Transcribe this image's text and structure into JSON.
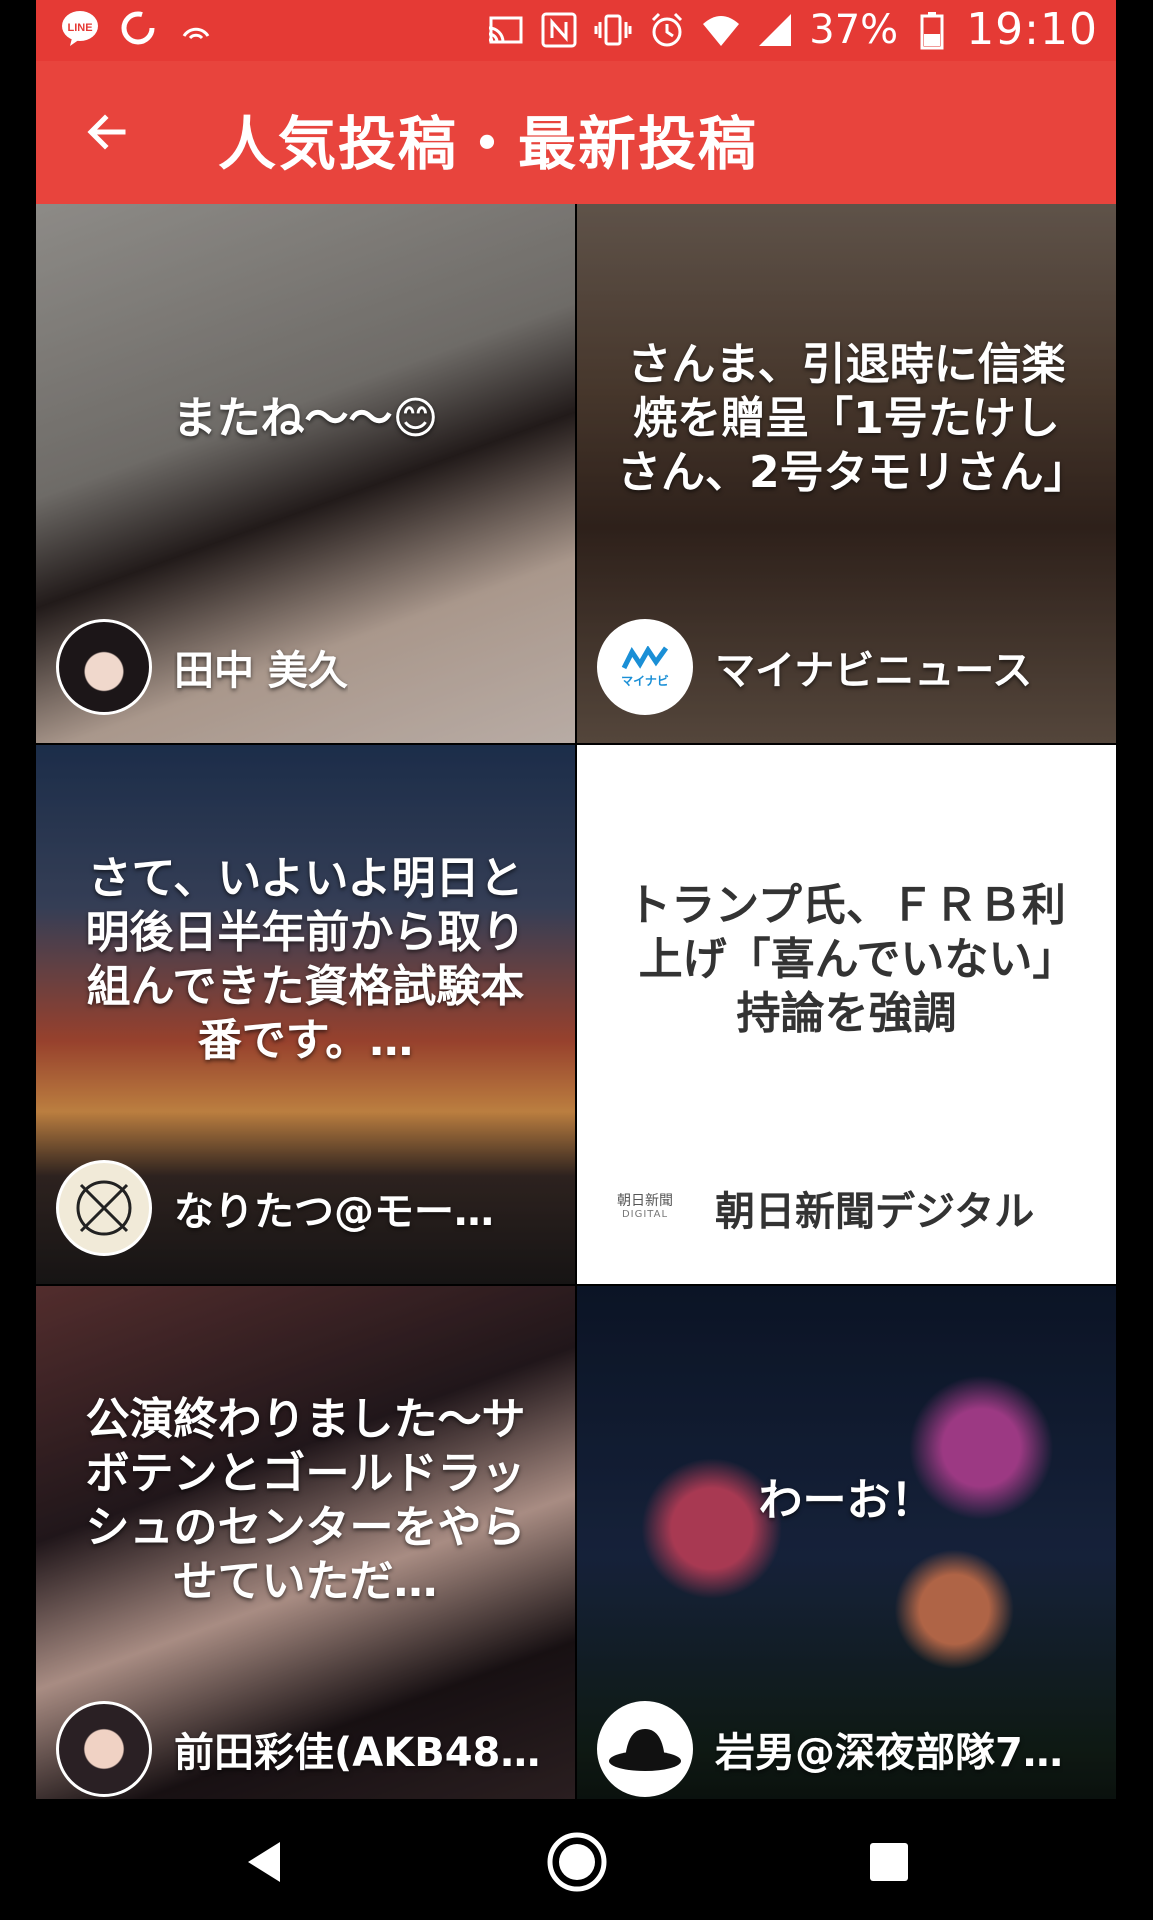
{
  "status_bar": {
    "battery": "37%",
    "time": "19:10",
    "icons": [
      "line-icon",
      "sync-icon",
      "signal-arc-icon",
      "cast-icon",
      "nfc-icon",
      "vibrate-icon",
      "alarm-icon",
      "wifi-icon",
      "cell-signal-icon",
      "battery-icon"
    ]
  },
  "app_bar": {
    "title": "人気投稿・最新投稿",
    "back_icon": "arrow-left-icon",
    "background": "#e8443d"
  },
  "posts": [
    {
      "headline": "またね〜〜😊",
      "author": "田中 美久"
    },
    {
      "headline": "さんま、引退時に信楽焼を贈呈「1号たけしさん、2号タモリさん」",
      "author": "マイナビニュース",
      "avatar_text": "マイナビ"
    },
    {
      "headline": "さて、いよいよ明日と明後日半年前から取り組んできた資格試験本番です。…",
      "author": "なりたつ@モー…"
    },
    {
      "headline": "トランプ氏、ＦＲＢ利上げ「喜んでいない」　持論を強調",
      "author": "朝日新聞デジタル",
      "avatar_text": "朝日新聞",
      "avatar_subtext": "DIGITAL"
    },
    {
      "headline": "公演終わりました〜サボテンとゴールドラッシュのセンターをやらせていただ…",
      "author": "前田彩佳(AKB48…"
    },
    {
      "headline": "わーお！",
      "author": "岩男@深夜部隊7…"
    }
  ],
  "nav_bar": {
    "icons": [
      "back-triangle-icon",
      "home-circle-icon",
      "recents-square-icon"
    ]
  }
}
